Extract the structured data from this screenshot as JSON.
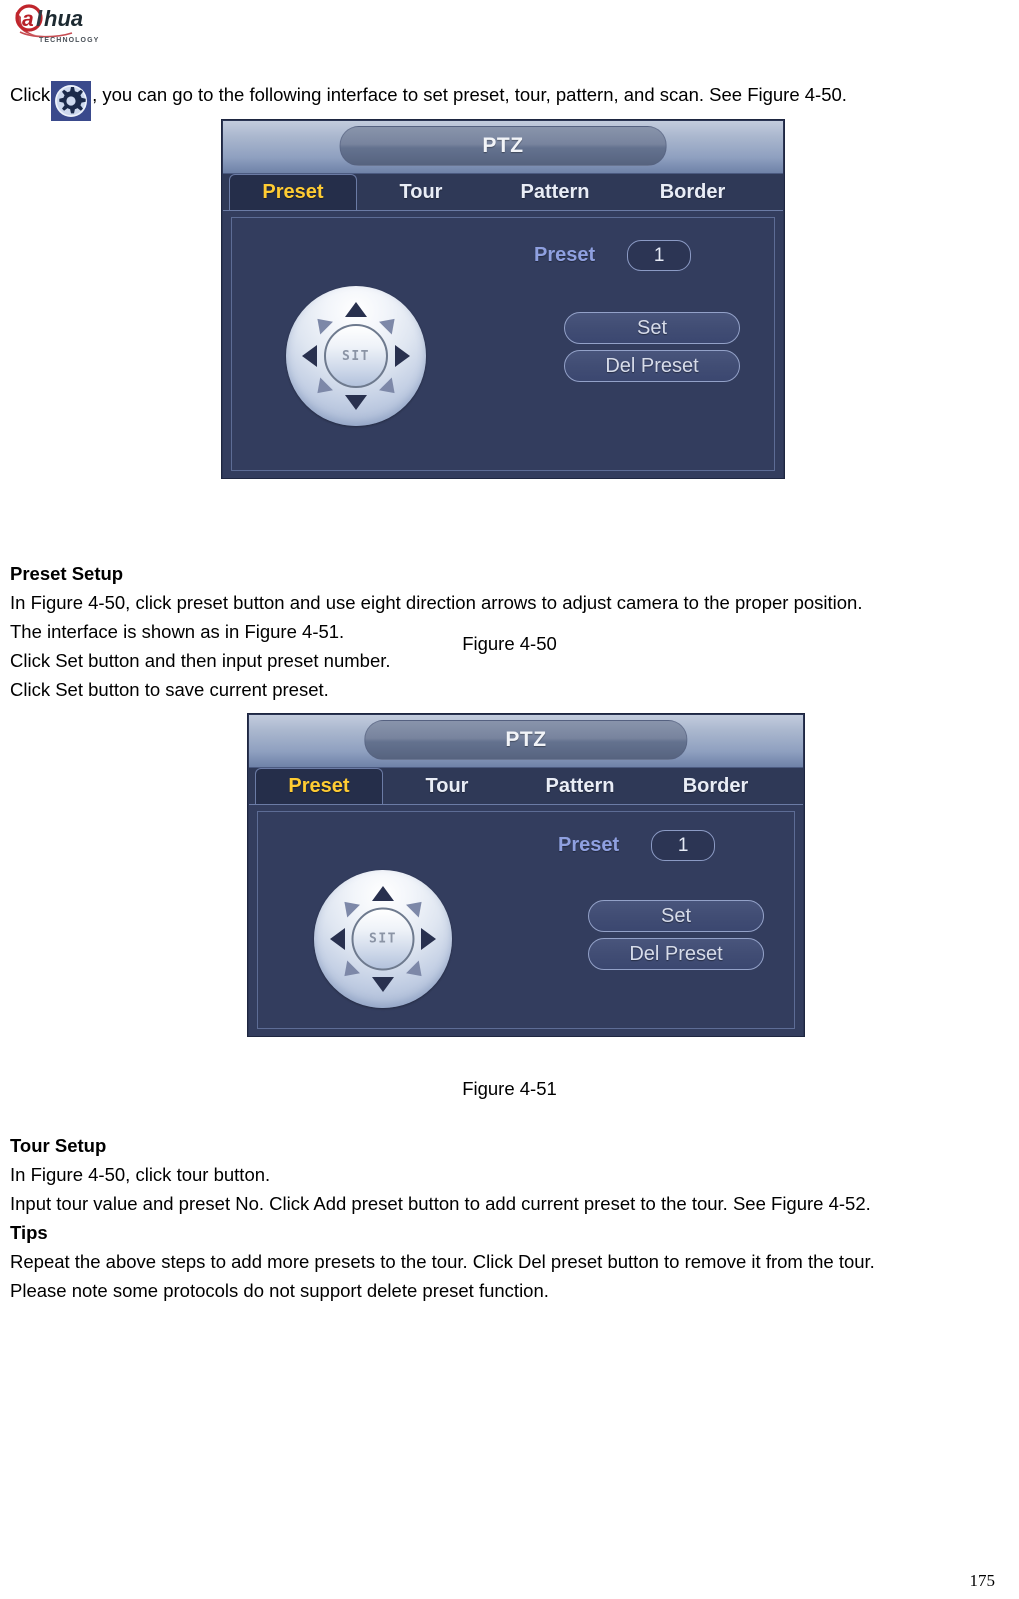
{
  "document": {
    "brand": {
      "name": "alhua",
      "name_a": "a",
      "name_rest": "hua",
      "tagline": "TECHNOLOGY"
    },
    "page_number": "175"
  },
  "intro": {
    "click_prefix": "Click",
    "gear_icon": "gear-icon",
    "click_suffix": ", you can go to the following interface to set preset, tour, pattern, and scan. See Figure 4-50."
  },
  "figures": {
    "fig_50_caption": "Figure 4-50",
    "fig_51_caption": "Figure 4-51"
  },
  "ptz_dialog": {
    "title": "PTZ",
    "tabs": [
      {
        "label": "Preset",
        "active": true
      },
      {
        "label": "Tour",
        "active": false
      },
      {
        "label": "Pattern",
        "active": false
      },
      {
        "label": "Border",
        "active": false
      }
    ],
    "preset_label": "Preset",
    "preset_value": "1",
    "set_button": "Set",
    "del_preset_button": "Del Preset",
    "joystick_center": "SIT",
    "colors": {
      "dialog_background": "#333d5e",
      "tab_active_text": "#ffcc33",
      "tab_inactive_text": "#e9edf6",
      "preset_label_text": "#8fa0e0",
      "button_text": "#d7dcea",
      "titlebar_gradient_top": "#c3ccdd",
      "titlebar_gradient_bottom": "#6f82a8"
    }
  },
  "sections": {
    "preset_setup": {
      "heading": "Preset Setup",
      "lines": [
        "In Figure 4-50, click preset button and use eight direction arrows to adjust camera to the proper position.",
        "The interface is shown as in Figure 4-51.",
        "Click Set button and then input preset number.",
        "Click Set button to save current preset."
      ]
    },
    "tour_setup": {
      "heading": "Tour Setup",
      "lines": [
        "In Figure 4-50, click tour button.",
        "Input tour value and preset No. Click Add preset button to add current preset to the tour. See Figure 4-52."
      ]
    },
    "tips": {
      "heading": "Tips",
      "lines": [
        "Repeat the above steps to add more presets to the tour. Click Del preset button to remove it from the tour.",
        "Please note some protocols do not support delete preset function."
      ]
    }
  }
}
